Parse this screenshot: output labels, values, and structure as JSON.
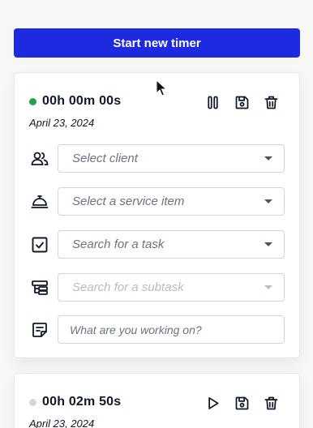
{
  "header": {
    "start_label": "Start new timer"
  },
  "timers": [
    {
      "elapsed": "00h 00m 00s",
      "date": "April 23, 2024",
      "status": "running",
      "status_color": "#22a34a",
      "actions": [
        "pause-icon",
        "save-icon",
        "trash-icon"
      ],
      "fields": {
        "client_placeholder": "Select client",
        "service_placeholder": "Select a service item",
        "task_placeholder": "Search for a task",
        "subtask_placeholder": "Search for a subtask",
        "notes_placeholder": "What are you working on?"
      }
    },
    {
      "elapsed": "00h 02m 50s",
      "date": "April 23, 2024",
      "status": "paused",
      "status_color": "#d6d6d6",
      "actions": [
        "play-icon",
        "save-icon",
        "trash-icon"
      ]
    }
  ],
  "colors": {
    "primary": "#1e2ae0",
    "running": "#22a34a"
  }
}
